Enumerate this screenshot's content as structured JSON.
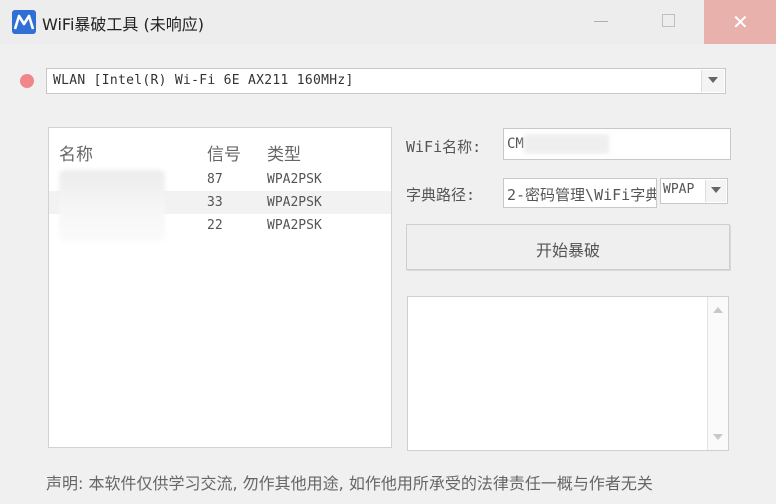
{
  "window": {
    "title": "WiFi暴破工具 (未响应)",
    "close_glyph": "✕"
  },
  "adapter": {
    "selected": "WLAN [Intel(R) Wi-Fi 6E AX211 160MHz]",
    "status_color": "#f0868a"
  },
  "wifi_list": {
    "headers": {
      "name": "名称",
      "signal": "信号",
      "type": "类型"
    },
    "rows": [
      {
        "name": "",
        "signal": "87",
        "type": "WPA2PSK"
      },
      {
        "name": "",
        "signal": "33",
        "type": "WPA2PSK"
      },
      {
        "name": "",
        "signal": "22",
        "type": "WPA2PSK"
      }
    ]
  },
  "form": {
    "ssid_label": "WiFi名称:",
    "ssid_value": "CM",
    "dict_label": "字典路径:",
    "dict_value": "2-密码管理\\WiFi字典",
    "mode_value": "WPAP"
  },
  "start_button": {
    "label": "开始暴破"
  },
  "footer": {
    "disclaimer": "声明: 本软件仅供学习交流, 勿作其他用途, 如作他用所承受的法律责任一概与作者无关"
  }
}
